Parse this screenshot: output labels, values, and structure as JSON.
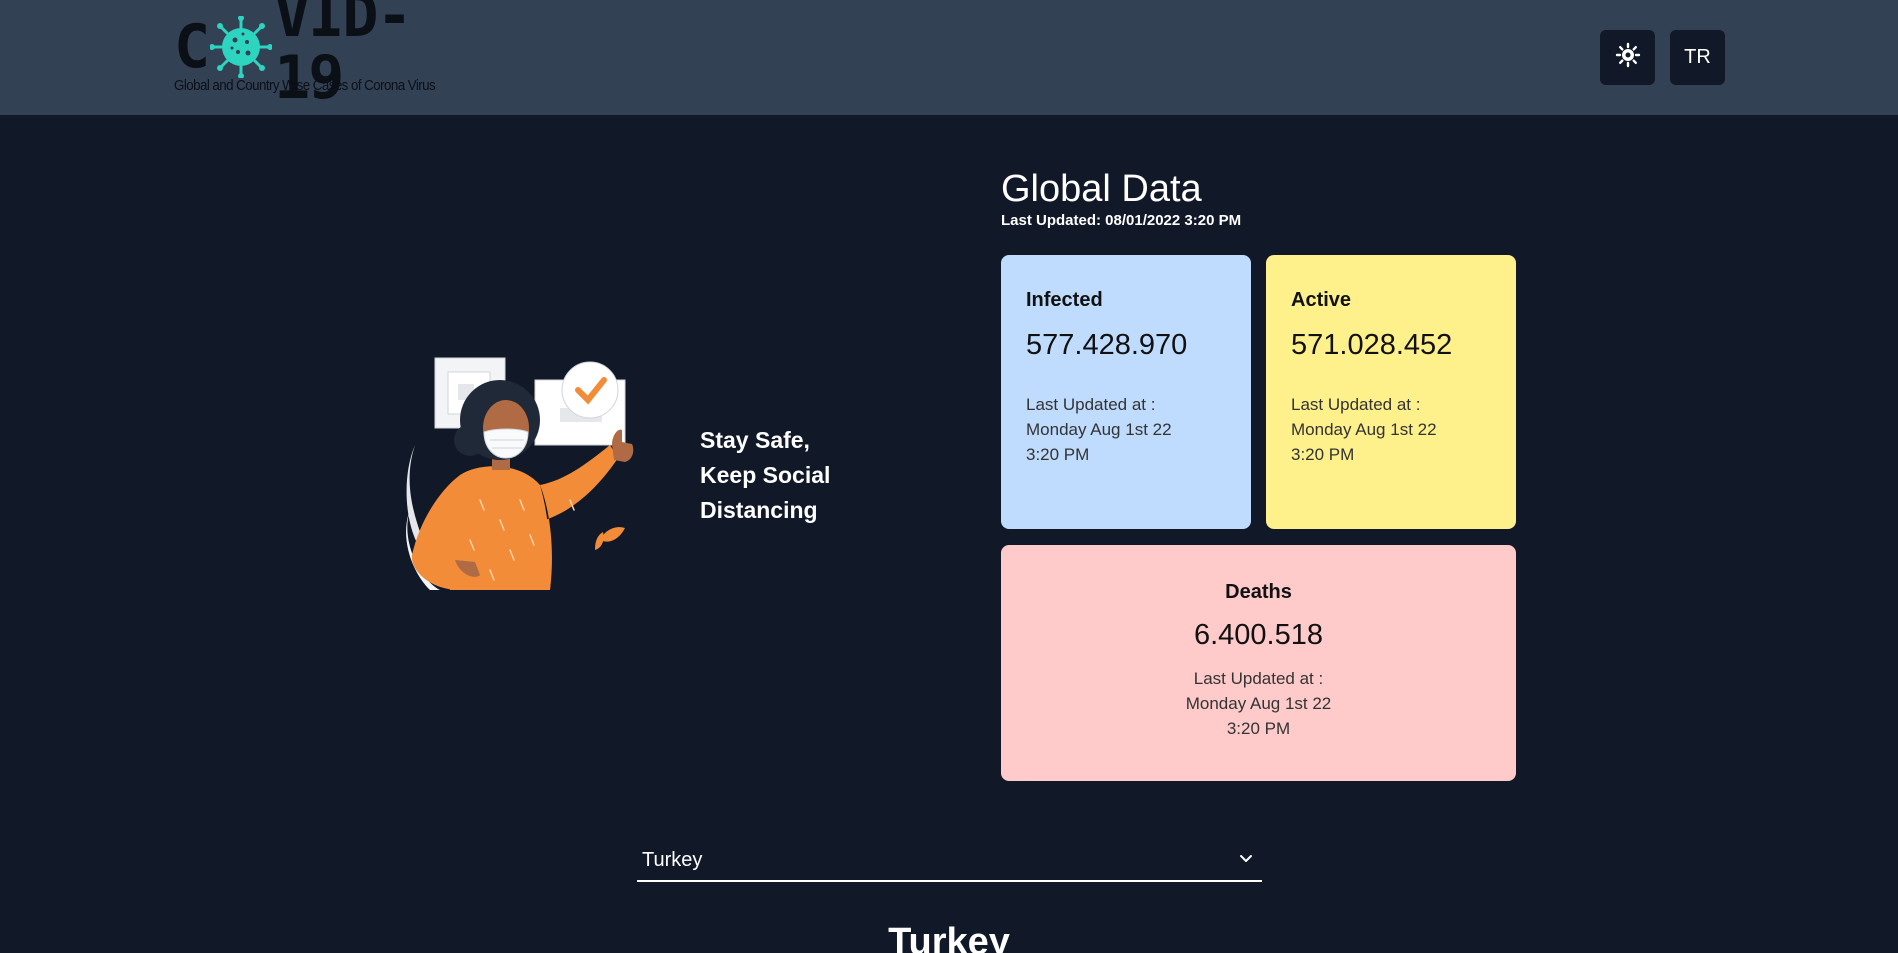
{
  "header": {
    "logo_title_left": "C",
    "logo_title_right": "VID-19",
    "logo_subtitle": "Global and Country Wise Cases of Corona Virus",
    "theme_icon": "sun-icon",
    "language_button": "TR"
  },
  "hero": {
    "slogan_line1": "Stay Safe,",
    "slogan_line2": "Keep Social",
    "slogan_line3": "Distancing"
  },
  "global": {
    "title": "Global Data",
    "last_updated": "Last Updated: 08/01/2022 3:20 PM",
    "cards": {
      "infected": {
        "title": "Infected",
        "value": "577.428.970",
        "note_line1": "Last Updated at :",
        "note_line2": "Monday Aug 1st 22",
        "note_line3": "3:20 PM",
        "color": "#bfdbfe"
      },
      "active": {
        "title": "Active",
        "value": "571.028.452",
        "note_line1": "Last Updated at :",
        "note_line2": "Monday Aug 1st 22",
        "note_line3": "3:20 PM",
        "color": "#fef08a"
      },
      "deaths": {
        "title": "Deaths",
        "value": "6.400.518",
        "note_line1": "Last Updated at :",
        "note_line2": "Monday Aug 1st 22",
        "note_line3": "3:20 PM",
        "color": "#fecaca"
      }
    }
  },
  "country": {
    "selected": "Turkey",
    "heading": "Turkey"
  },
  "colors": {
    "background": "#111827",
    "header": "#334155",
    "virus": "#2dd4bf"
  }
}
